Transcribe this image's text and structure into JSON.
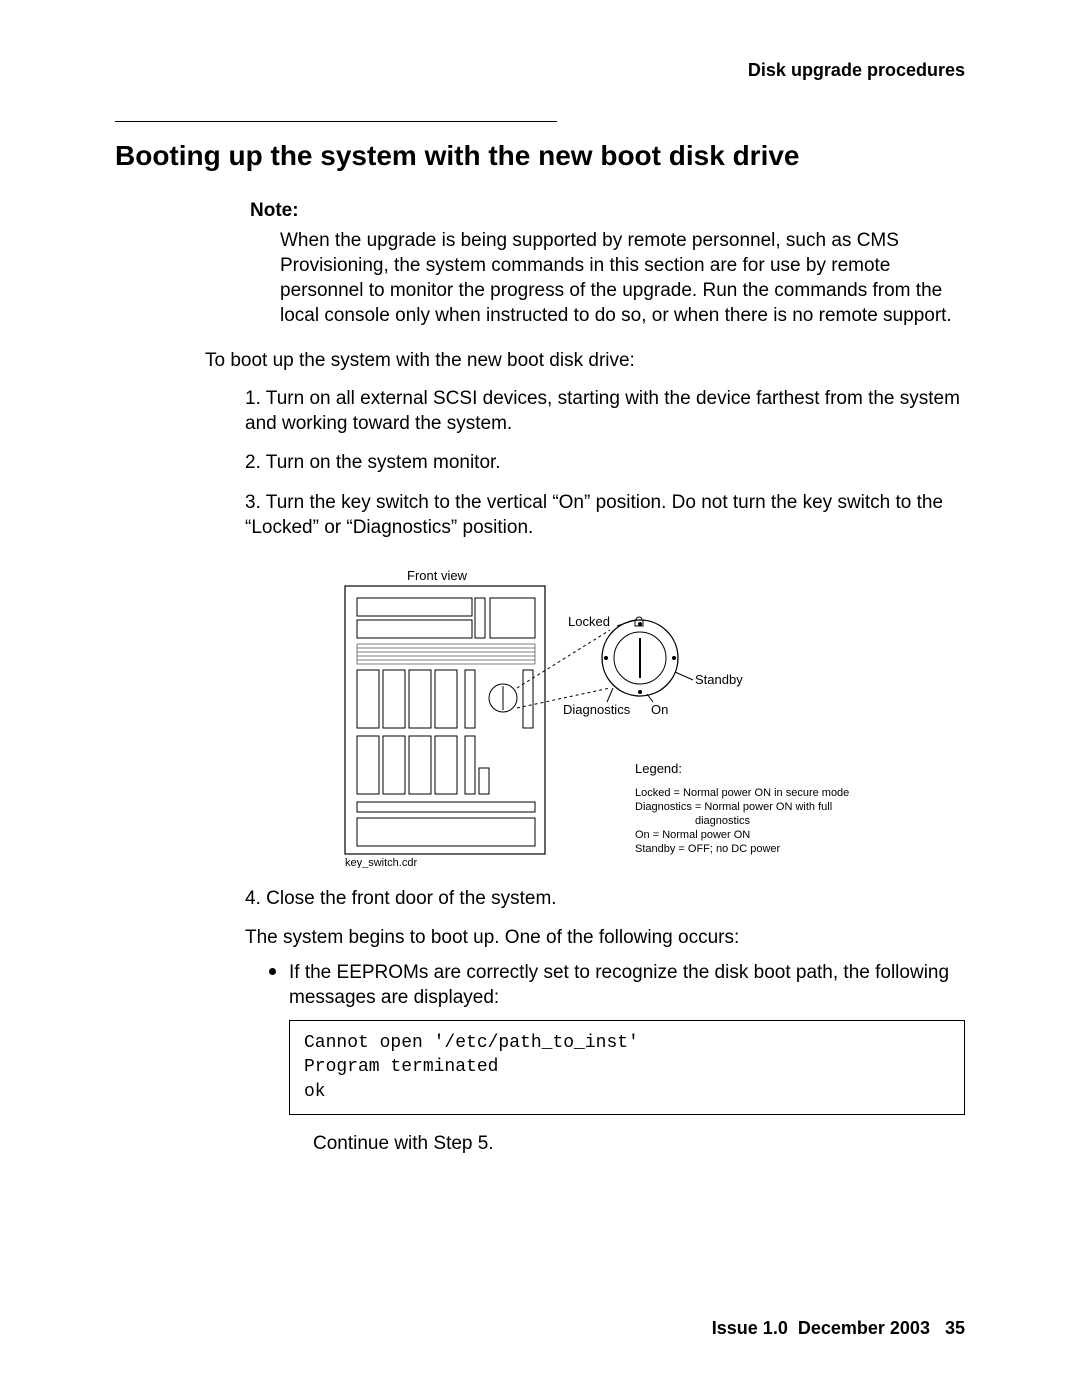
{
  "header": {
    "section": "Disk upgrade procedures"
  },
  "title": "Booting up the system with the new boot disk drive",
  "note": {
    "label": "Note:",
    "body": "When the upgrade is being supported by remote personnel, such as CMS Provisioning, the system commands in this section are for use by remote personnel to monitor the progress of the upgrade. Run the commands from the local console only when instructed to do so, or when there is no remote support."
  },
  "intro": "To boot up the system with the new boot disk drive:",
  "steps": {
    "s1": {
      "num": "1.",
      "text": "Turn on all external SCSI devices, starting with the device farthest from the system and working toward the system."
    },
    "s2": {
      "num": "2.",
      "text": "Turn on the system monitor."
    },
    "s3": {
      "num": "3.",
      "text": "Turn the key switch to the vertical “On” position. Do not turn the key switch to the “Locked” or “Diagnostics” position."
    },
    "s4": {
      "num": "4.",
      "text": "Close the front door of the system.",
      "sub": "The system begins to boot up. One of the following occurs:",
      "bullet1": "If the EEPROMs are correctly set to recognize the disk boot path, the following messages are displayed:",
      "code": "Cannot open '/etc/path_to_inst'\nProgram terminated\nok",
      "continue": "Continue with Step 5."
    }
  },
  "figure": {
    "front_view": "Front view",
    "locked": "Locked",
    "standby": "Standby",
    "diagnostics": "Diagnostics",
    "on": "On",
    "legend_title": "Legend:",
    "legend_locked": "Locked = Normal power ON in secure mode",
    "legend_diag": "Diagnostics = Normal power ON with full",
    "legend_diag2": "diagnostics",
    "legend_on": "On = Normal power ON",
    "legend_standby": "Standby = OFF; no DC power",
    "caption": "key_switch.cdr"
  },
  "footer": {
    "issue": "Issue 1.0",
    "date": "December 2003",
    "page": "35"
  }
}
